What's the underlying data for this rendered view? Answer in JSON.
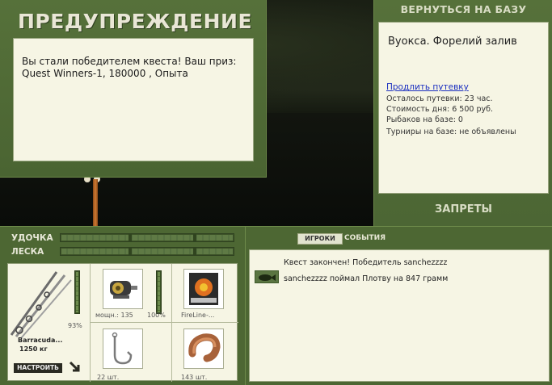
{
  "warning": {
    "title": "ПРЕДУПРЕЖДЕНИЕ",
    "line1": "Вы стали победителем квеста! Ваш приз:",
    "line2": "Quest Winners-1, 180000 , Опыта"
  },
  "info": {
    "return_label": "ВЕРНУТЬСЯ НА БАЗУ",
    "place": "Вуокса. Форелий залив",
    "extend_link": "Продлить путевку",
    "remaining": "Осталось путевки: 23 час.",
    "day_cost": "Стоимость дня: 6 500 руб.",
    "anglers": "Рыбаков на базе: 0",
    "tournaments": "Турниры на базе: не объявлены",
    "bans_label": "ЗАПРЕТЫ"
  },
  "gauges": {
    "rod_label": "УДОЧКА",
    "line_label": "ЛЕСКА"
  },
  "tackle": {
    "rod_name": "Barracuda...",
    "rod_weight": "1250 кг",
    "rod_percent": "93%",
    "setup_label": "НАСТРОИТЬ",
    "reel_power": "мощн.: 135",
    "reel_percent": "100%",
    "line_name": "FireLine-...",
    "hook_count": "22 шт.",
    "bait_count": "143 шт."
  },
  "chat": {
    "tab_players": "ИГРОКИ",
    "tab_events": "СОБЫТИЯ",
    "messages": [
      "Квест закончен! Победитель sanchezzzz",
      "sanchezzzz поймал Плотву на 847 грамм"
    ]
  },
  "colors": {
    "panel_green": "#56713a",
    "card_bg": "#f6f5e4",
    "link_blue": "#1a2ec0"
  },
  "icons": {
    "rod": "fishing-rod-icon",
    "reel": "reel-icon",
    "line_spool": "line-spool-icon",
    "hook": "hook-icon",
    "bait": "bait-icon",
    "fish": "fish-icon",
    "arrow": "diagonal-arrow-icon"
  }
}
